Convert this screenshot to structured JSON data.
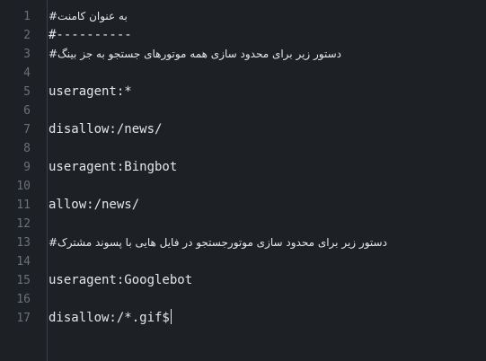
{
  "editor": {
    "lines": [
      {
        "number": "1",
        "text": "به عنوان کامنت#"
      },
      {
        "number": "2",
        "text": "#----------"
      },
      {
        "number": "3",
        "text": "دستور زیر برای محدود سازی همه موتورهای جستجو به جز بینگ#"
      },
      {
        "number": "4",
        "text": ""
      },
      {
        "number": "5",
        "text": "useragent:*"
      },
      {
        "number": "6",
        "text": ""
      },
      {
        "number": "7",
        "text": "disallow:/news/"
      },
      {
        "number": "8",
        "text": ""
      },
      {
        "number": "9",
        "text": "useragent:Bingbot"
      },
      {
        "number": "10",
        "text": ""
      },
      {
        "number": "11",
        "text": "allow:/news/"
      },
      {
        "number": "12",
        "text": ""
      },
      {
        "number": "13",
        "text": "دستور زیر برای محدود سازی موتورجستجو در فایل هایی با پسوند مشترک#"
      },
      {
        "number": "14",
        "text": ""
      },
      {
        "number": "15",
        "text": "useragent:Googlebot"
      },
      {
        "number": "16",
        "text": ""
      },
      {
        "number": "17",
        "text": "disallow:/*.gif$"
      }
    ]
  }
}
